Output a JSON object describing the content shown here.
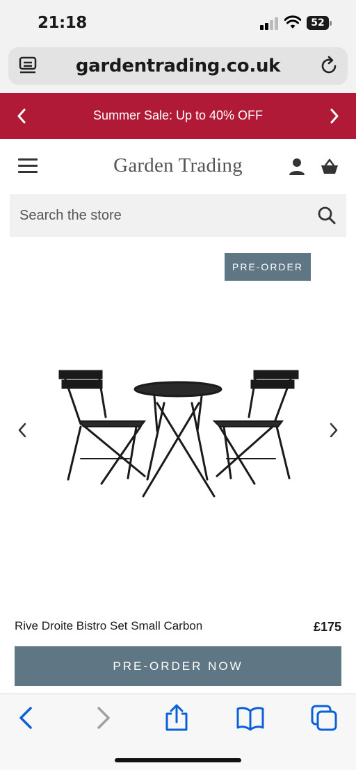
{
  "status_bar": {
    "time": "21:18",
    "battery": "52",
    "icons": [
      "signal-icon",
      "wifi-icon",
      "battery-icon"
    ]
  },
  "browser": {
    "url": "gardentrading.co.uk",
    "icons": [
      "tab-overview-icon",
      "reload-icon"
    ]
  },
  "promo_banner": {
    "text": "Summer Sale: Up to 40% OFF",
    "background_color": "#b01a36",
    "icons": [
      "chevron-left-icon",
      "chevron-right-icon"
    ]
  },
  "header": {
    "logo": "Garden Trading",
    "icons": [
      "menu-icon",
      "account-icon",
      "basket-icon"
    ]
  },
  "search": {
    "placeholder": "Search the store",
    "icon": "search-icon"
  },
  "product": {
    "badge": "PRE-ORDER",
    "name": "Rive Droite Bistro Set Small Carbon",
    "price": "£175",
    "button_label": "PRE-ORDER NOW",
    "accent_color": "#5f7784",
    "image_icon": "bistro-set-image",
    "gallery_icons": [
      "gallery-prev-icon",
      "gallery-next-icon"
    ]
  },
  "toolbar": {
    "icons": [
      "back-icon",
      "forward-icon",
      "share-icon",
      "bookmarks-icon",
      "tabs-icon"
    ],
    "accent_color": "#0a60d8"
  }
}
